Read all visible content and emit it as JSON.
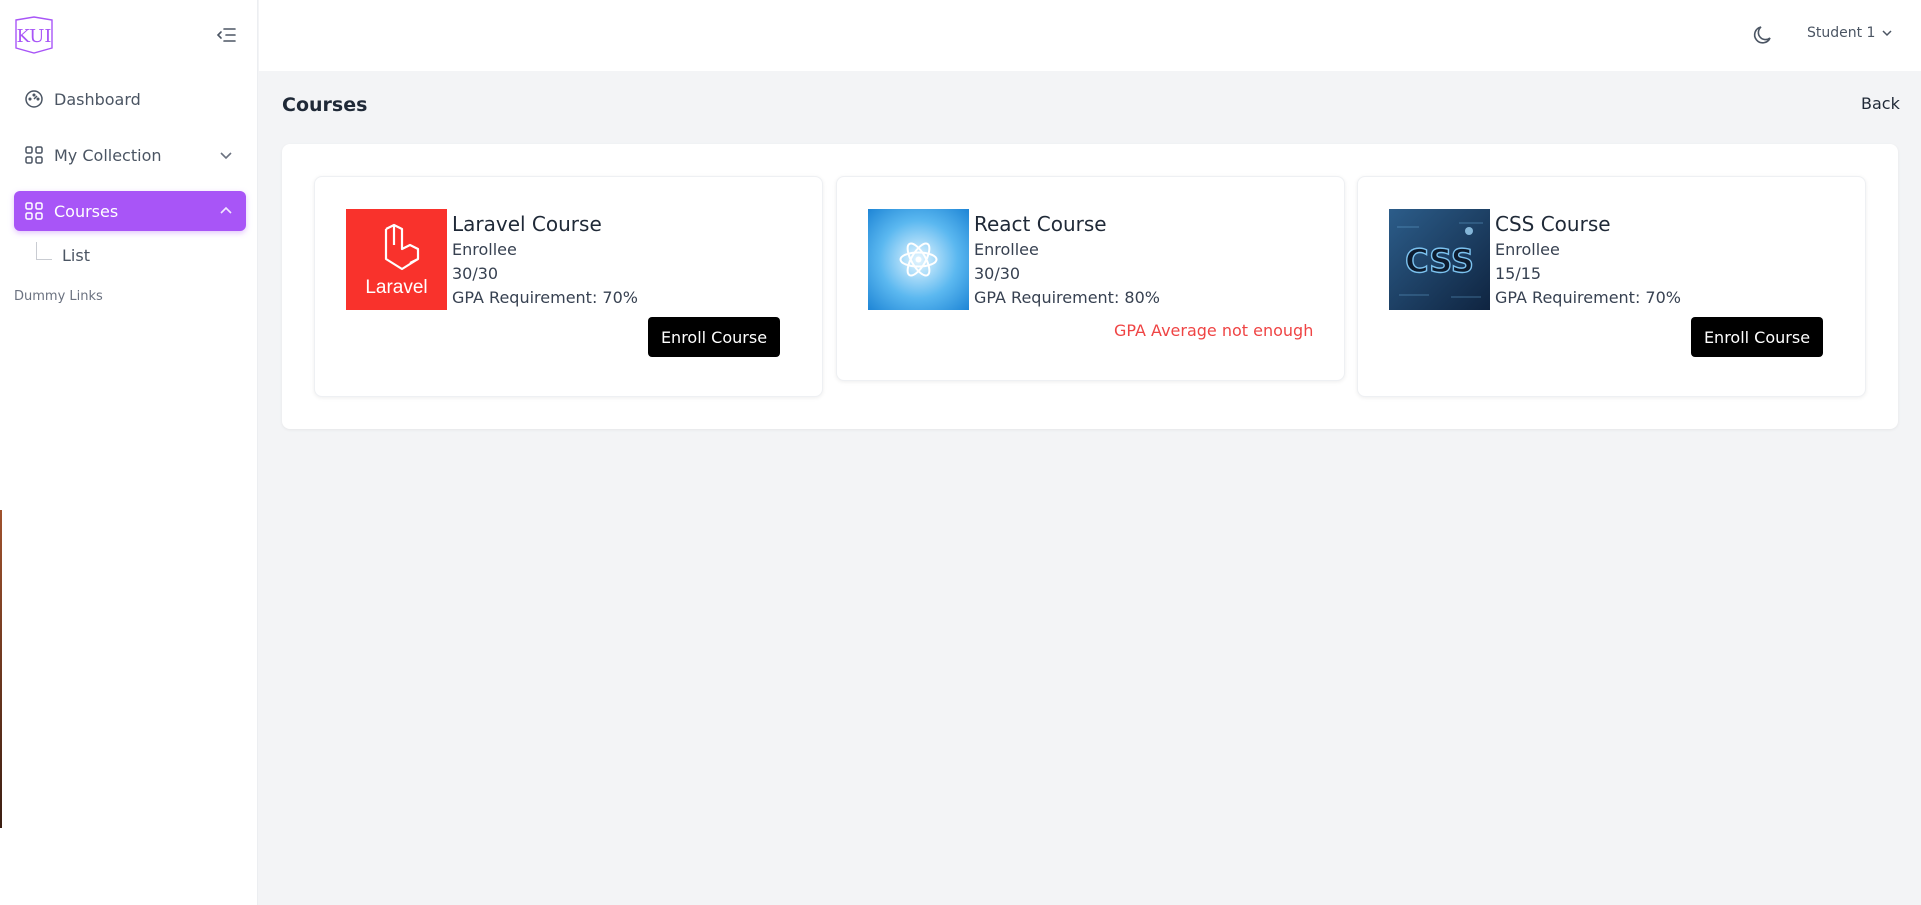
{
  "sidebar": {
    "logo_text": "KUI",
    "items": [
      {
        "label": "Dashboard"
      },
      {
        "label": "My Collection"
      },
      {
        "label": "Courses"
      }
    ],
    "sub_items": [
      {
        "label": "List"
      }
    ],
    "section_label": "Dummy Links"
  },
  "header": {
    "user_label": "Student 1"
  },
  "page": {
    "title": "Courses",
    "back_label": "Back"
  },
  "courses": [
    {
      "title": "Laravel Course",
      "enrollee_label": "Enrollee",
      "enrollee_count": "30/30",
      "gpa_requirement": "GPA Requirement: 70%",
      "action_label": "Enroll Course",
      "thumb_text": "Laravel"
    },
    {
      "title": "React Course",
      "enrollee_label": "Enrollee",
      "enrollee_count": "30/30",
      "gpa_requirement": "GPA Requirement: 80%",
      "warning": "GPA Average not enough"
    },
    {
      "title": "CSS Course",
      "enrollee_label": "Enrollee",
      "enrollee_count": "15/15",
      "gpa_requirement": "GPA Requirement: 70%",
      "action_label": "Enroll Course",
      "thumb_text": "CSS"
    }
  ],
  "colors": {
    "accent": "#a855f7",
    "button": "#000000",
    "warning": "#ef4444",
    "laravel": "#f9322c",
    "react_bg": "#5bb8f0",
    "css_bg": "#1e3a5f"
  },
  "icons": {
    "dashboard": "gauge-icon",
    "my_collection": "grid-icon",
    "courses": "grid-icon",
    "collapse": "menu-collapse-icon",
    "theme": "moon-icon"
  }
}
